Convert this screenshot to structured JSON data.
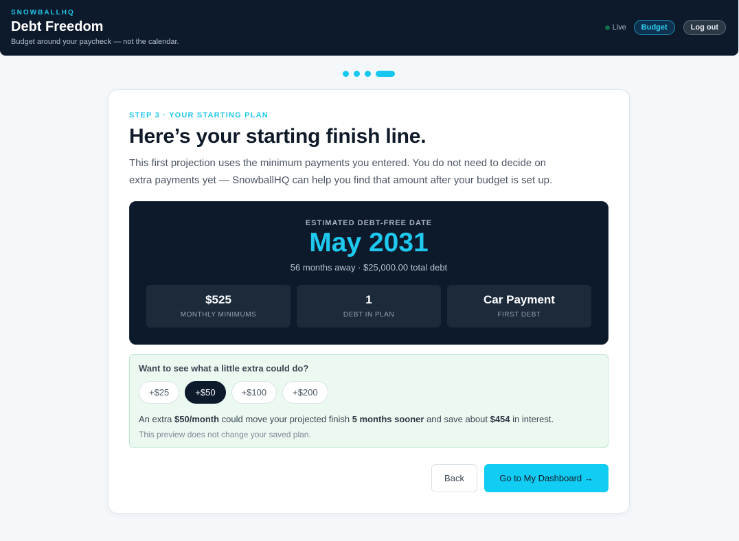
{
  "header": {
    "kicker": "SNOWBALLHQ",
    "title": "Debt Freedom",
    "subtitle": "Budget around your paycheck — not the calendar.",
    "live_label": "Live",
    "budget_label": "Budget",
    "logout_label": "Log out"
  },
  "stepper": {
    "total_steps": 4,
    "current_step": 4
  },
  "card": {
    "step_kicker": "STEP 3 · YOUR STARTING PLAN",
    "headline": "Here’s your starting finish line.",
    "intro": "This first projection uses the minimum payments you entered. You do not need to decide on extra payments yet — SnowballHQ can help you find that amount after your budget is set up."
  },
  "summary": {
    "label": "ESTIMATED DEBT-FREE DATE",
    "date": "May 2031",
    "sub": "56 months away · $25,000.00 total debt",
    "stats": [
      {
        "value": "$525",
        "label": "MONTHLY MINIMUMS"
      },
      {
        "value": "1",
        "label": "DEBT IN PLAN"
      },
      {
        "value": "Car Payment",
        "label": "FIRST DEBT"
      }
    ]
  },
  "extra": {
    "title": "Want to see what a little extra could do?",
    "chips": [
      "+$25",
      "+$50",
      "+$100",
      "+$200"
    ],
    "selected_chip": "+$50",
    "msg_prefix": "An extra ",
    "msg_amount": "$50/month",
    "msg_mid": " could move your projected finish ",
    "msg_months": "5 months sooner",
    "msg_mid2": " and save about ",
    "msg_savings": "$454",
    "msg_suffix": " in interest.",
    "note": "This preview does not change your saved plan."
  },
  "actions": {
    "back_label": "Back",
    "go_label": "Go to My Dashboard →"
  },
  "colors": {
    "accent": "#16c8ef",
    "dark": "#0c1a2b",
    "success_bg": "#ecf9f1"
  }
}
